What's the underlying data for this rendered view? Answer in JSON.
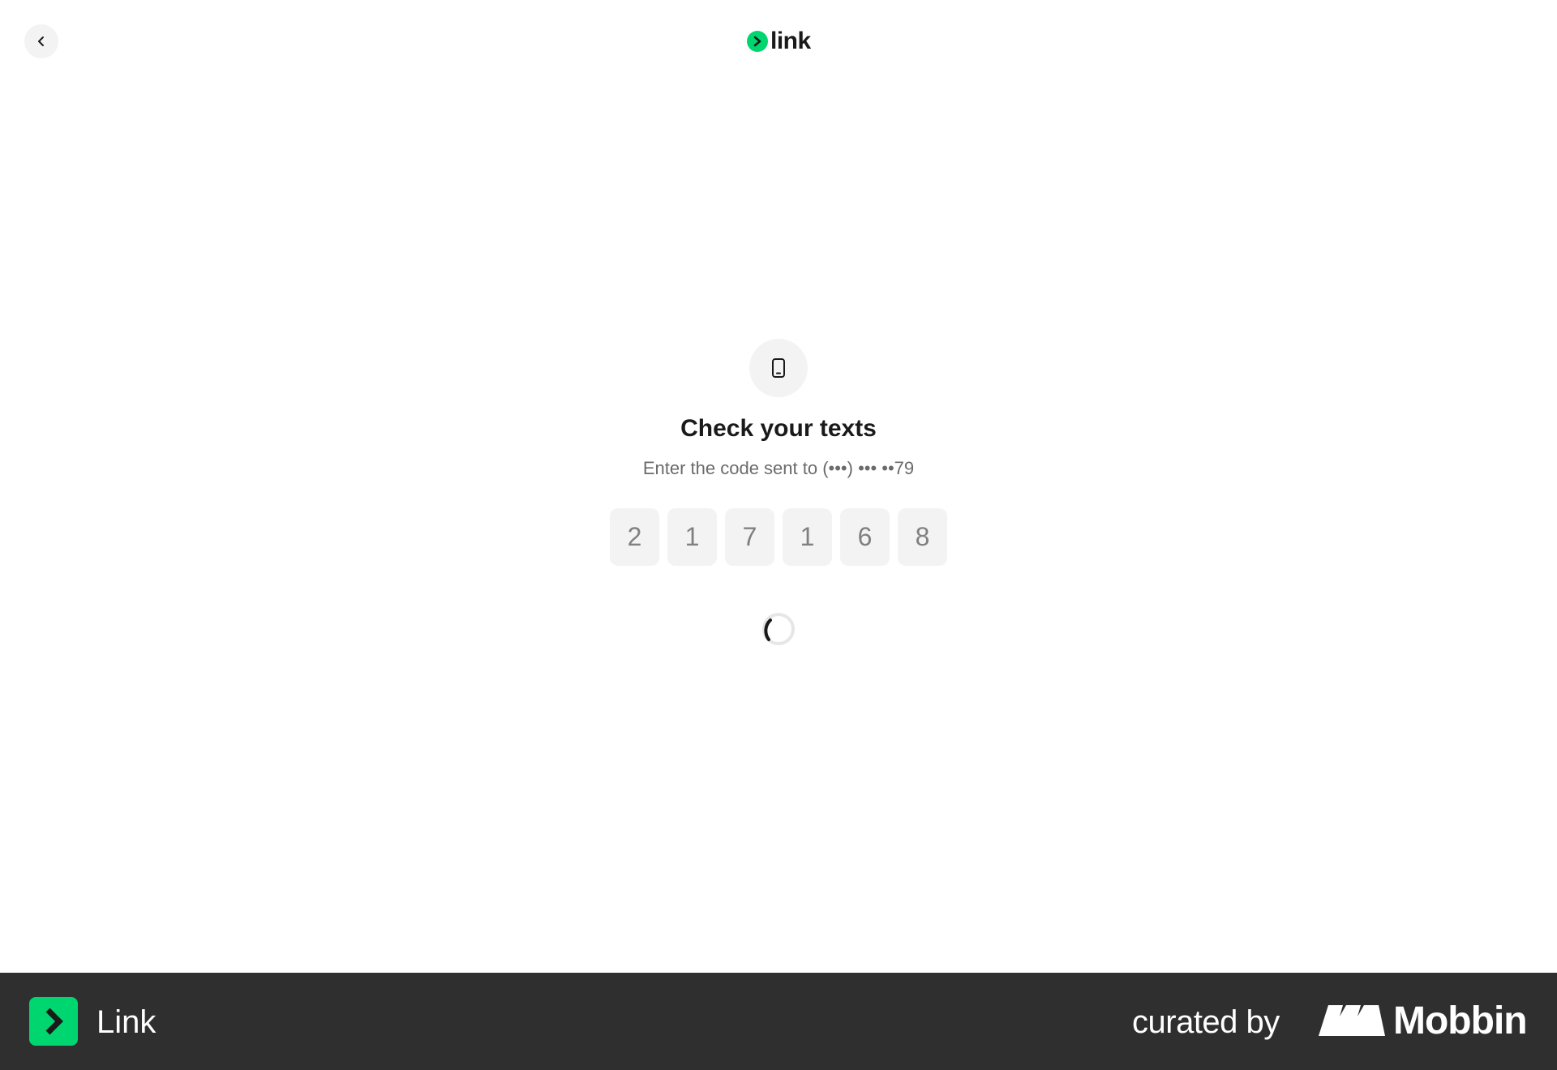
{
  "header": {
    "back_icon": "chevron-left-icon",
    "logo_text": "link",
    "logo_color": "#00d66f"
  },
  "verification": {
    "icon": "phone-icon",
    "title": "Check your texts",
    "subtitle": "Enter the code sent to (•••) ••• ••79",
    "code_digits": [
      "2",
      "1",
      "7",
      "1",
      "6",
      "8"
    ],
    "status": "loading"
  },
  "footer": {
    "app_name": "Link",
    "curated_by": "curated by",
    "brand": "Mobbin",
    "background": "#2f2f2f"
  }
}
